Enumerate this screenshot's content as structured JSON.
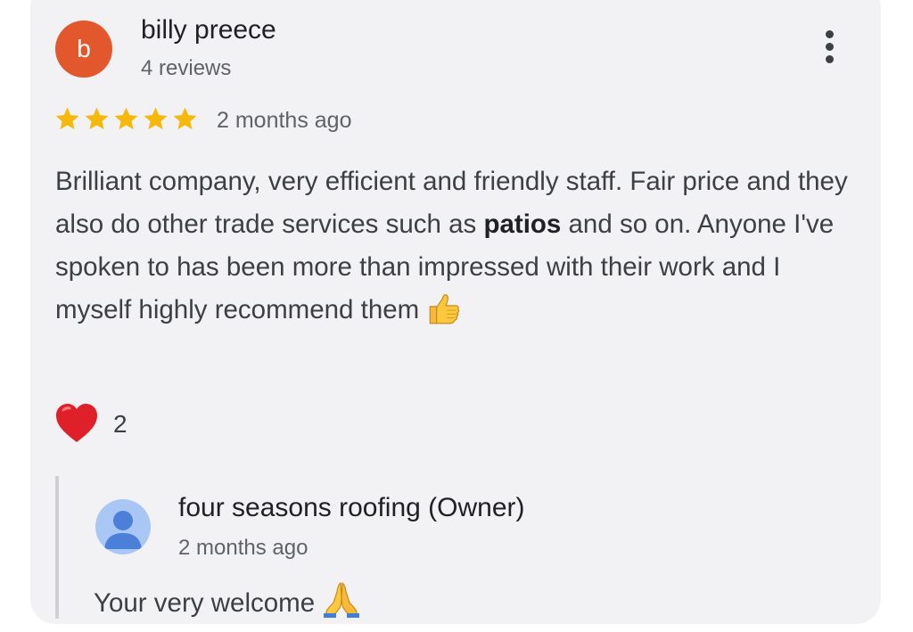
{
  "review": {
    "avatar_letter": "b",
    "avatar_color": "#e2572b",
    "reviewer_name": "billy preece",
    "review_count": "4 reviews",
    "rating": 5,
    "rating_max": 5,
    "star_color": "#f6b90b",
    "time_ago": "2 months ago",
    "text_before": "Brilliant company, very efficient and friendly staff. Fair price and they also do other trade services such as ",
    "text_bold": "patios",
    "text_after": " and so on. Anyone I've spoken to has been more than impressed with their work and I myself highly recommend them",
    "trailing_emoji": "thumbs-up-emoji",
    "more_icon": "more-vert-icon"
  },
  "reactions": {
    "icon": "heart-icon",
    "count": "2"
  },
  "owner_reply": {
    "avatar_icon": "person-icon",
    "name": "four seasons roofing (Owner)",
    "time_ago": "2 months ago",
    "text": "Your very welcome",
    "trailing_emoji": "folded-hands-emoji"
  }
}
